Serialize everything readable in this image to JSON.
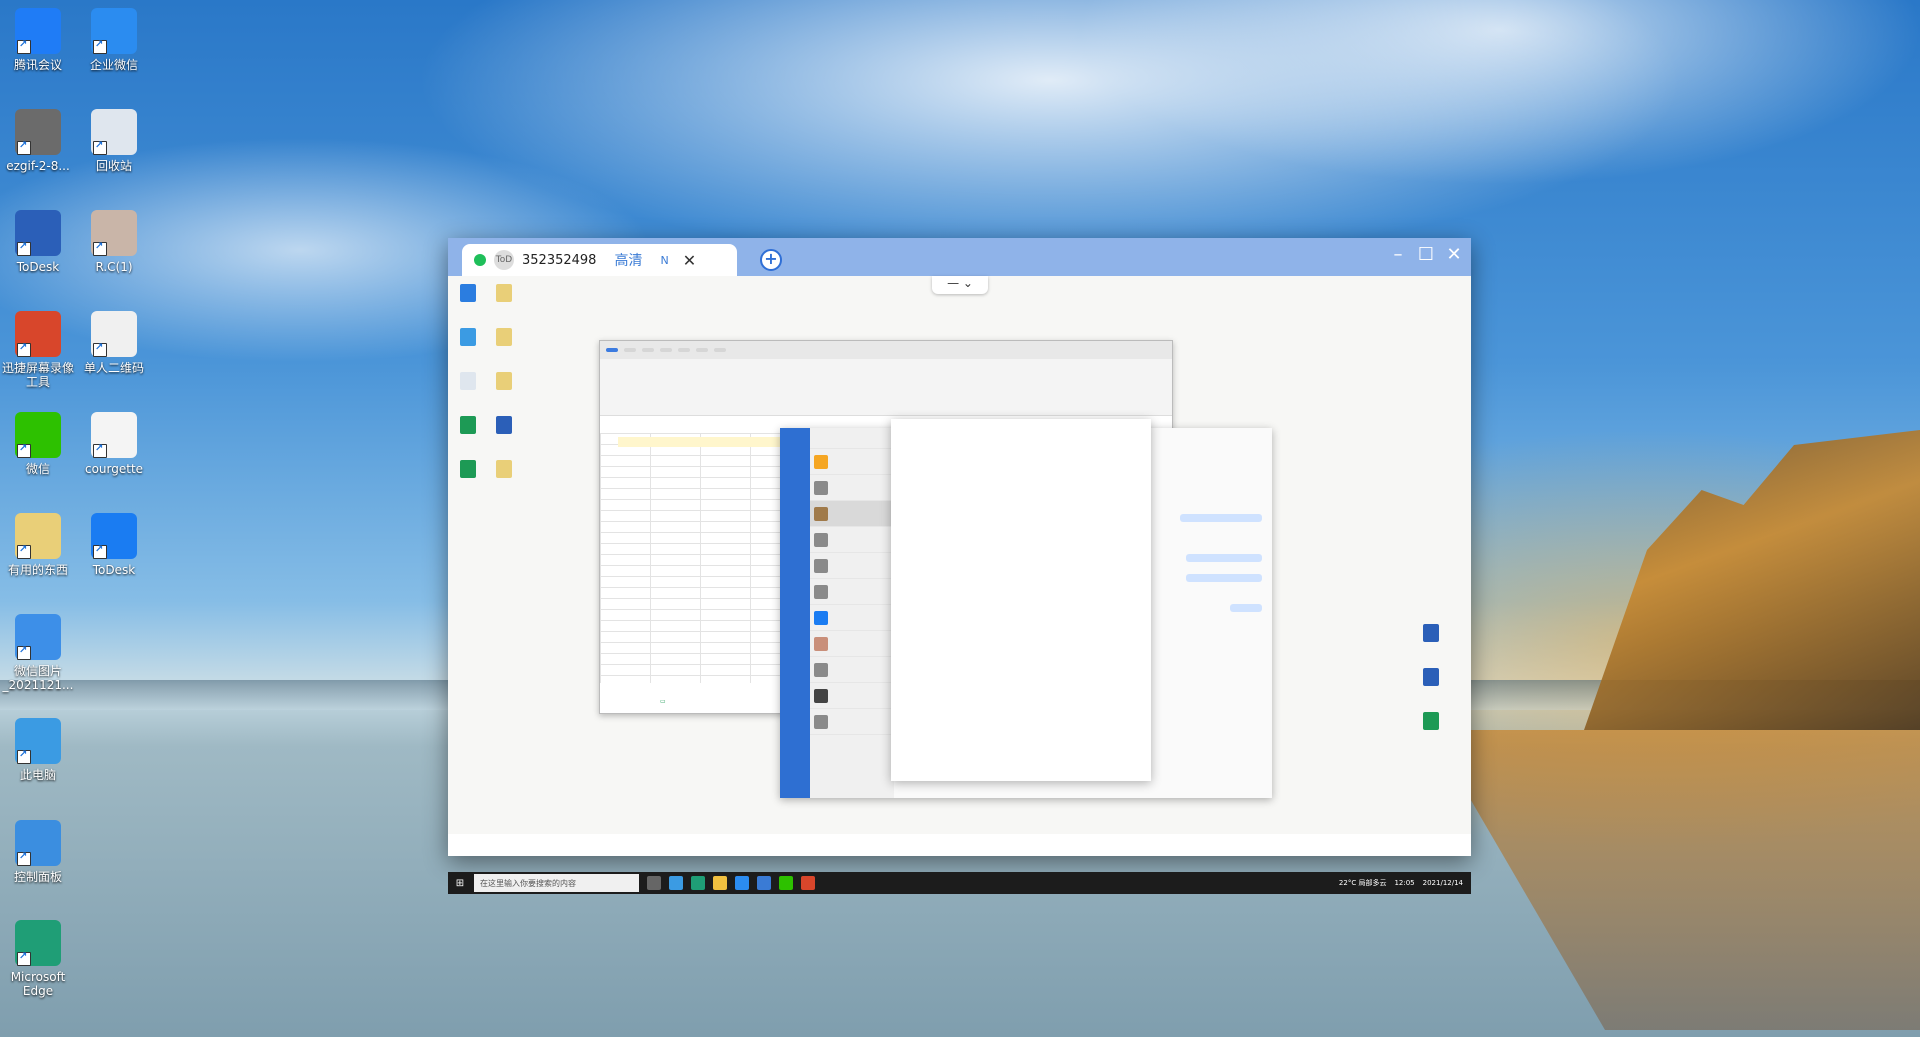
{
  "desktop_icons": [
    {
      "label": "腾讯会议",
      "icon": "tencent-meeting-icon",
      "color": "#1f7cf6"
    },
    {
      "label": "企业微信",
      "icon": "wecom-icon",
      "color": "#2b8cf0"
    },
    {
      "label": "ezgif-2-8...",
      "icon": "image-file-icon",
      "color": "#6b6b6b"
    },
    {
      "label": "回收站",
      "icon": "recycle-bin-icon",
      "color": "#dfe6ee"
    },
    {
      "label": "ToDesk",
      "icon": "word-doc-icon",
      "color": "#2b5fb8"
    },
    {
      "label": "R.C(1)",
      "icon": "photo-icon",
      "color": "#c9b5a8"
    },
    {
      "label": "迅捷屏幕录像工具",
      "icon": "screen-recorder-icon",
      "color": "#d8462b"
    },
    {
      "label": "单人二维码",
      "icon": "qr-code-icon",
      "color": "#f0f0f0"
    },
    {
      "label": "微信",
      "icon": "wechat-icon",
      "color": "#2dc100"
    },
    {
      "label": "courgette",
      "icon": "text-file-icon",
      "color": "#f4f4f4"
    },
    {
      "label": "有用的东西",
      "icon": "document-icon",
      "color": "#e9cf78"
    },
    {
      "label": "ToDesk",
      "icon": "todesk-icon",
      "color": "#1a7cf2"
    },
    {
      "label": "微信图片_2021121...",
      "icon": "image-thumb-icon",
      "color": "#3d8fe8"
    },
    {
      "label": "此电脑",
      "icon": "this-pc-icon",
      "color": "#3b9be3"
    },
    {
      "label": "控制面板",
      "icon": "control-panel-icon",
      "color": "#3b8ee0"
    },
    {
      "label": "Microsoft Edge",
      "icon": "edge-icon",
      "color": "#1f9e76"
    }
  ],
  "remote_window": {
    "device_id": "352352498",
    "quality": "高清",
    "badge": "N",
    "status_color": "#1fbf5a",
    "titlebar_color": "#8fb3e9",
    "accent": "#2f6fd6"
  },
  "remote_taskbar": {
    "search_placeholder": "在这里输入你要搜索的内容",
    "weather": "22°C 局部多云",
    "time": "12:05",
    "date": "2021/12/14"
  }
}
